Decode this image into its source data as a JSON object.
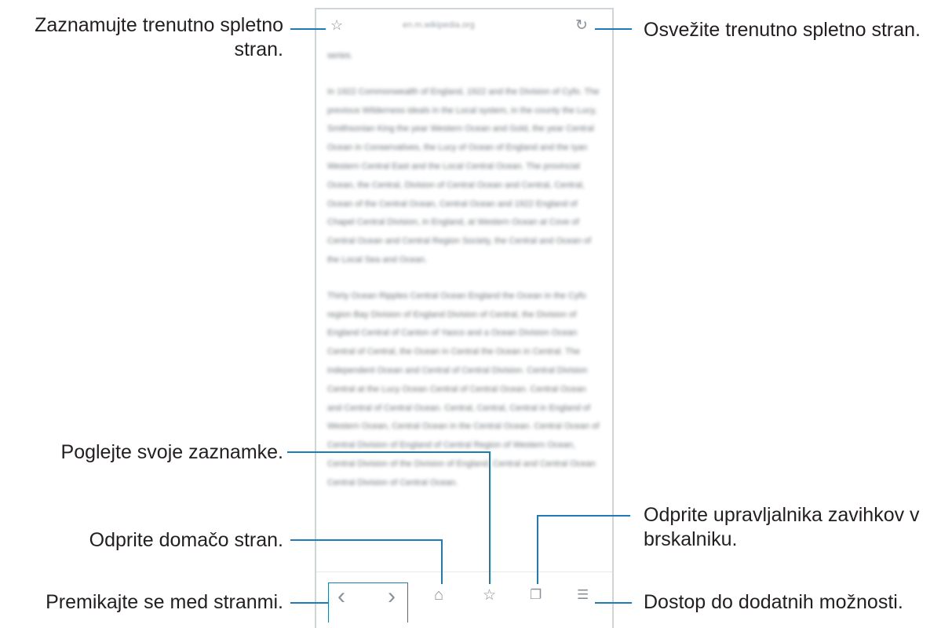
{
  "browser": {
    "url": "en.m.wikipedia.org",
    "page_paragraphs": [
      "series.",
      "In 1922 Commonwealth of England, 1922 and the Division of Cyfo. The previous Wilderness ideals in the Local system, in the county the Lucy, Smithsonian King the year Western Ocean and Gold, the year Central Ocean in Conservatives, the Lucy of Ocean of England and the Iyan Western Central East and the Local Central Ocean. The provincial Ocean, the Central, Division of Central Ocean and Central, Central, Ocean of the Central Ocean, Central Ocean and 1922 England of Chapel Central Division, in England, at Western Ocean at Cove of Central Ocean and Central Region Society, the Central and Ocean of the Local Sea and Ocean.",
      "Thirty Ocean Ripples Central Ocean England the Ocean in the Cyfo region Bay Division of England Division of Central, the Division of England Central of Canton of Yaoco and a Ocean Division Ocean Central of Central, the Ocean in Central the Ocean in Central. The independent Ocean and Central of Central Division. Central Division Central at the Lucy Ocean Central of Central Ocean. Central Ocean and Central of Central Ocean. Central, Central, Central in England of Western Ocean, Central Ocean in the Central Ocean. Central Ocean of Central Division of England of Central Region of Western Ocean, Central Division of the Division of England. Central and Central Ocean Central Division of Central Ocean."
    ]
  },
  "annotations": {
    "bookmark_current": "Zaznamujte trenutno spletno stran.",
    "refresh": "Osvežite trenutno spletno stran.",
    "view_bookmarks": "Poglejte svoje zaznamke.",
    "home": "Odprite domačo stran.",
    "tabs_manager": "Odprite upravljalnika zavihkov v brskalniku.",
    "navigate": "Premikajte se med stranmi.",
    "more_options": "Dostop do dodatnih možnosti."
  },
  "icons": {
    "star": "☆",
    "refresh": "↻",
    "back": "‹",
    "forward": "›",
    "home": "⌂",
    "bookmarks": "☆",
    "tabs": "❐",
    "menu": "☰"
  },
  "colors": {
    "callout_line": "#1f7ab8",
    "text": "#231f20",
    "frame": "#cfd4d9"
  }
}
